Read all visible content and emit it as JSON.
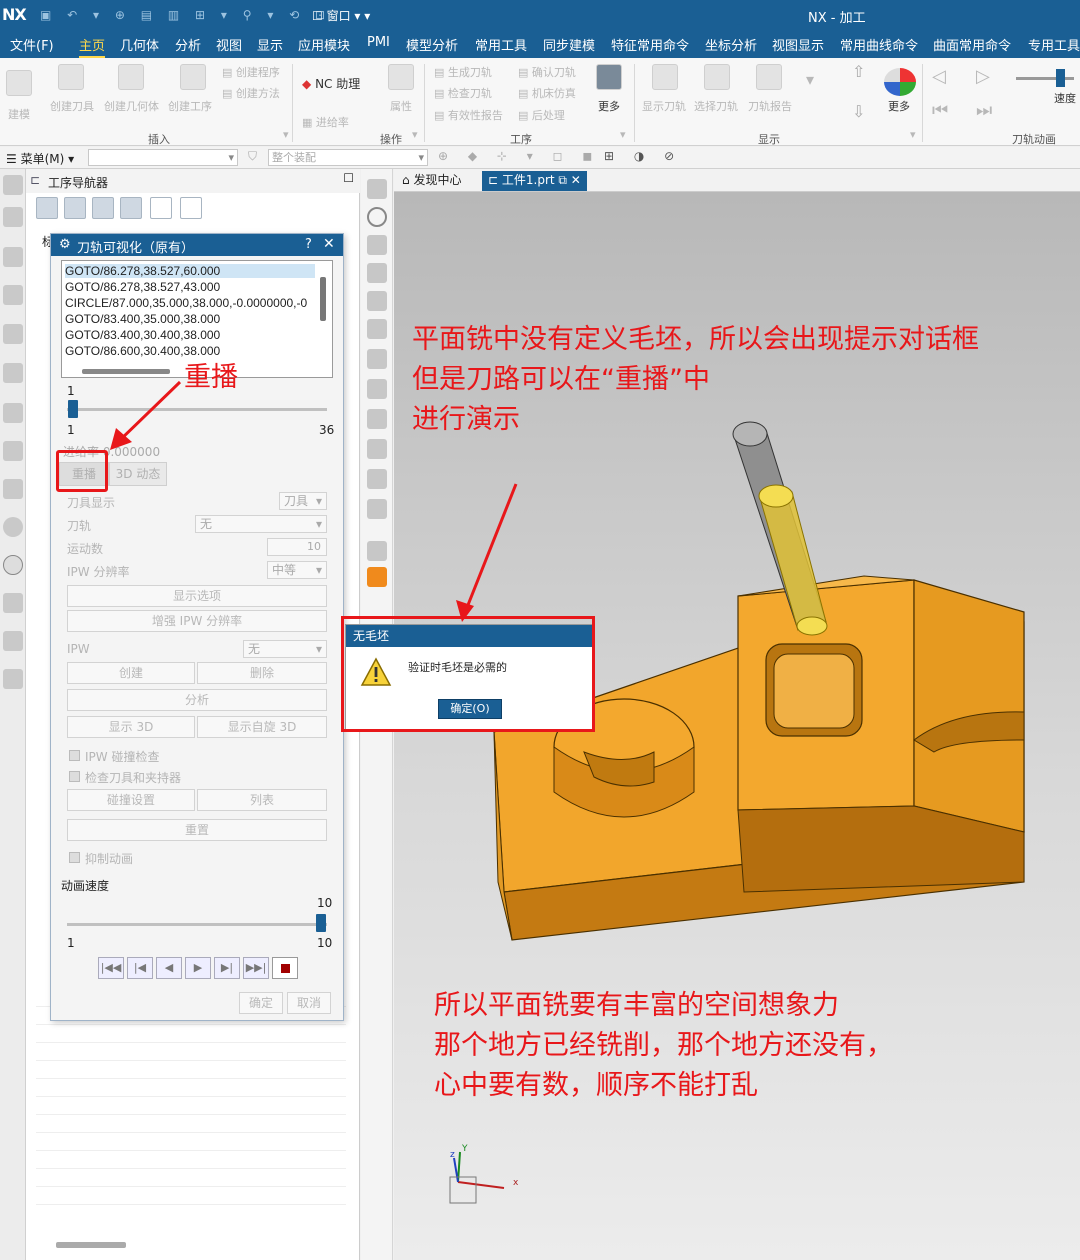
{
  "app": {
    "logo": "NX",
    "window_menu": "窗口",
    "title": "NX - 加工"
  },
  "menu": [
    "文件(F)",
    "主页",
    "几何体",
    "分析",
    "视图",
    "显示",
    "应用模块",
    "PMI",
    "模型分析",
    "常用工具",
    "同步建模",
    "特征常用命令",
    "坐标分析",
    "视图显示",
    "常用曲线命令",
    "曲面常用命令",
    "专用工具"
  ],
  "ribbon": {
    "create": [
      "建模",
      "创建刀具",
      "创建几何体",
      "创建工序"
    ],
    "create_small": [
      "创建程序",
      "创建方法"
    ],
    "nc_helper": "NC 助理",
    "feedrate": "进给率",
    "attribute": "属性",
    "more1": "更多",
    "op_small": [
      "生成刀轨",
      "检查刀轨",
      "有效性报告",
      "确认刀轨",
      "机床仿真",
      "后处理"
    ],
    "display": [
      "显示刀轨",
      "选择刀轨",
      "刀轨报告"
    ],
    "more2": "更多",
    "speed": "速度",
    "groups": [
      "插入",
      "操作",
      "工序",
      "显示",
      "刀轨动画"
    ]
  },
  "toolbar2": {
    "menu": "菜单(M)",
    "assembly": "整个装配"
  },
  "navigator": {
    "title": "工序导航器",
    "name_col": "标"
  },
  "dialog": {
    "title": "刀轨可视化（原有）",
    "help": "?",
    "close": "✕",
    "cls_lines": [
      "GOTO/86.278,38.527,60.000",
      "GOTO/86.278,38.527,43.000",
      "CIRCLE/87.000,35.000,38.000,-0.0000000,-0",
      "GOTO/83.400,35.000,38.000",
      "GOTO/83.400,30.400,38.000",
      "GOTO/86.600,30.400,38.000"
    ],
    "slider1_value": "1",
    "slider1_min": "1",
    "slider1_max": "36",
    "feedrate": "进给率 0.000000",
    "tabs": [
      "重播",
      "3D 动态"
    ],
    "tool_display": "刀具显示",
    "tool_display_value": "刀具",
    "toolpath": "刀轨",
    "toolpath_value": "无",
    "motion_count": "运动数",
    "motion_count_value": "10",
    "ipw_res": "IPW 分辨率",
    "ipw_res_value": "中等",
    "display_options": "显示选项",
    "enhance_ipw": "增强 IPW 分辨率",
    "ipw": "IPW",
    "ipw_value": "无",
    "create": "创建",
    "delete": "删除",
    "analyze": "分析",
    "show3d": "显示 3D",
    "show_rotate3d": "显示自旋 3D",
    "ipw_collision": "IPW 碰撞检查",
    "check_tool_holder": "检查刀具和夹持器",
    "collision_settings": "碰撞设置",
    "list": "列表",
    "reset": "重置",
    "suppress_anim": "抑制动画",
    "anim_speed": "动画速度",
    "speed_value": "10",
    "speed_min": "1",
    "speed_max": "10",
    "ok": "确定",
    "cancel": "取消"
  },
  "view_tabs": [
    "发现中心",
    "工件1.prt"
  ],
  "message_box": {
    "title": "无毛坯",
    "text": "验证时毛坯是必需的",
    "ok": "确定(O)"
  },
  "annotations": {
    "replay_label": "重播",
    "note1": [
      "平面铣中没有定义毛坯，所以会出现提示对话框",
      "但是刀路可以在“重播”中",
      "进行演示"
    ],
    "note2": [
      "所以平面铣要有丰富的空间想象力",
      "那个地方已经铣削，那个地方还没有，",
      "心中要有数，顺序不能打乱"
    ]
  },
  "axis": {
    "x": "x",
    "y": "Y",
    "z": "z"
  },
  "colors": {
    "accent": "#1a5f94",
    "part": "#f0a52c",
    "annotation": "#e8171a",
    "tool": "#e0c237"
  }
}
